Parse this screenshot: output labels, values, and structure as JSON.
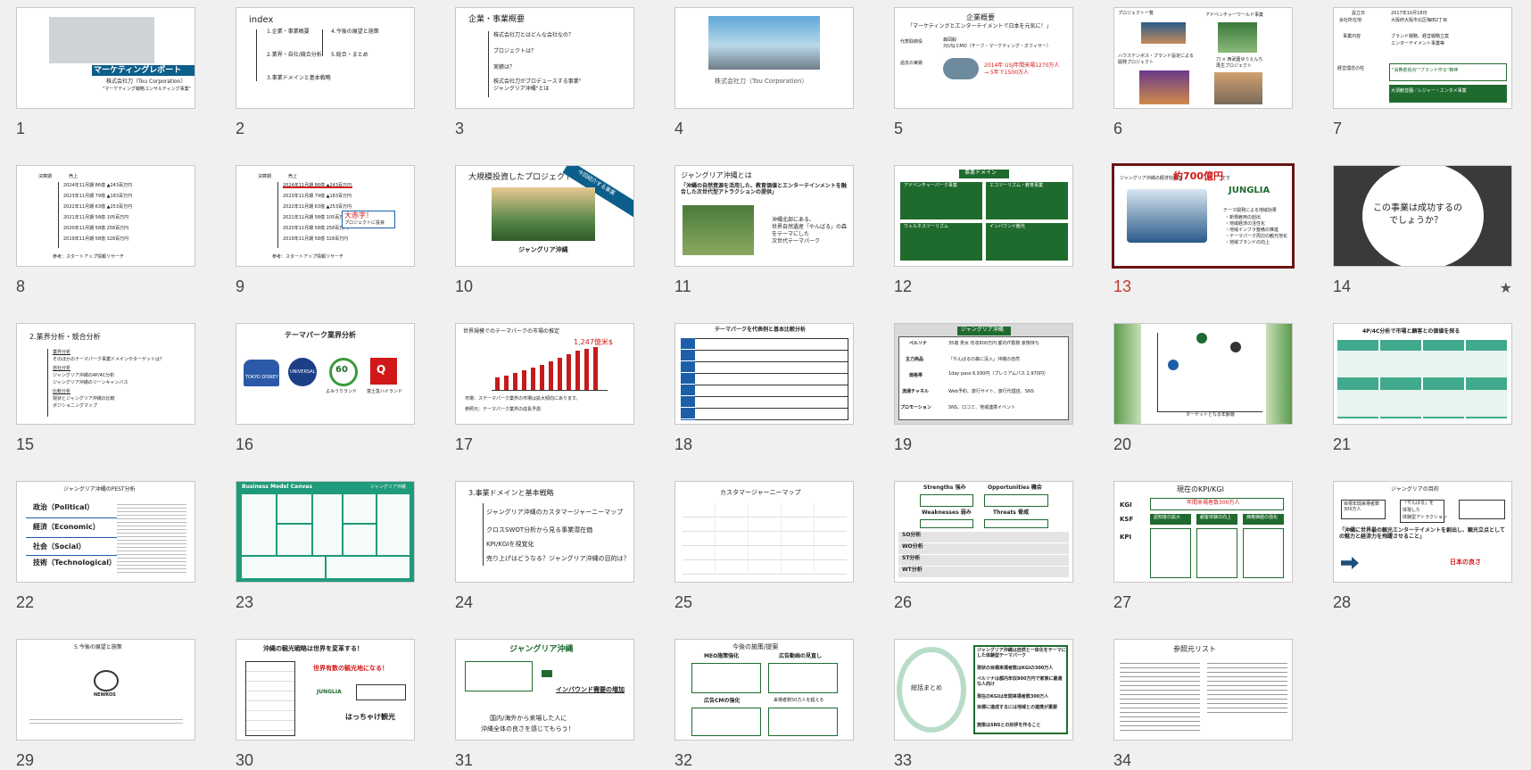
{
  "colors": {
    "accent": "#6b1414",
    "selected_number": "#c0392b",
    "background": "#f0f0f0"
  },
  "slides": [
    {
      "n": "1",
      "title": "マーケティングレポート",
      "l1": "株式会社刀（Tou Corporation）",
      "l2": "\"マーケティング戦略コンサルティング事業\""
    },
    {
      "n": "2",
      "title": "index",
      "items": [
        "1.企業・事業概要",
        "2.業界・自社/競合分析",
        "3.事業ドメインと基本戦略",
        "4.今後の展望と施策",
        "5.総合・まとめ"
      ]
    },
    {
      "n": "3",
      "title": "企業・事業概要",
      "items": [
        "株式会社刀とはどんな会社なの？",
        "プロジェクトは？",
        "実績は？",
        "株式会社刀がプロデュースする事業\"",
        "ジャングリア沖縄\"とは"
      ]
    },
    {
      "n": "4",
      "caption": "株式会社刀（Tou Corporation）"
    },
    {
      "n": "5",
      "title": "企業概要",
      "quote": "「マーケティングとエンターテイメントで日本を元気に！」",
      "labels": [
        "代表取締役",
        "森岡毅",
        "元USJ CMO（チーフ・マーケティング・オフィサー）",
        "過去の実績"
      ],
      "hl1": "2014年 USJ年間来場1270万人",
      "hl2": "→ 5年で1500万人"
    },
    {
      "n": "6",
      "labels": [
        "プロジェクト一覧",
        "アドベンチャーワールド事業",
        "ハウステンボス・ブランド設定による",
        "刀 × 西武園ゆうえんち",
        "再生プロジェクト",
        "開発プロジェクト"
      ]
    },
    {
      "n": "7",
      "rows": [
        "設立日",
        "2017年10月18日",
        "会社所在地",
        "大阪府大阪市北区梅田2丁目",
        "事業内容",
        "ブランド戦略、経営戦略立案",
        "エンターテイメント事業等",
        "経営理念の柱"
      ],
      "band1": "\"消費者視点\"\"ブランド作る\"精神",
      "band2": "大須観音園／レジャー・エンタメ事業"
    },
    {
      "n": "8",
      "head": [
        "決算期",
        "売上"
      ],
      "rows": [
        "2024年11月期 86億 ▲243百万円",
        "2023年11月期 79億 ▲183百万円",
        "2022年11月期 63億 ▲253百万円",
        "2021年11月期 58億 105百万円",
        "2020年11月期 58億 258百万円",
        "2019年11月期 58億 328百万円"
      ],
      "src": "参考：スタートアップ情報リサーチ"
    },
    {
      "n": "9",
      "head": [
        "決算期",
        "売上"
      ],
      "rows": [
        "2024年11月期 86億 ▲243百万円",
        "2023年11月期 79億 ▲183百万円",
        "2022年11月期 63億 ▲253百万円",
        "2021年11月期 58億 105百万円",
        "2020年11月期 58億 258百万円",
        "2019年11月期 58億 328百万円"
      ],
      "callout": "大赤字！",
      "callout2": "プロジェクトに投資",
      "src": "参考：スタートアップ情報リサーチ"
    },
    {
      "n": "10",
      "title": "大規模投資したプロジェクト",
      "ribbon": "今回紹介する事業",
      "caption": "ジャングリア沖縄"
    },
    {
      "n": "11",
      "title": "ジャングリア沖縄とは",
      "quote": "「沖縄の自然資源を活用した、教育価値とエンターテインメントを融合した次世代型アトラクションの提供」",
      "right1": "沖縄北部にある、",
      "right2": "世界自然遺産「やんばる」の森",
      "right3": "をテーマにした",
      "right4": "次世代テーマパーク"
    },
    {
      "n": "12",
      "title": "事業ドメイン",
      "quads": [
        "アドベンチャーパーク事業",
        "エコツーリズム・教育事業",
        "ウェルネスツーリズム",
        "インバウンド観光"
      ]
    },
    {
      "n": "13",
      "head1": "ジャングリア沖縄の経済効果は",
      "big": "約700億円",
      "head2": "です",
      "brand": "JUNGLIA",
      "bullets": [
        "テーマ開発による地域効果",
        "・新規雇用の創出",
        "・地域経済の活性化",
        "・地域インフラ整備の推進",
        "・テーマパーク周辺の観光地化",
        "・地域ブランドの向上"
      ]
    },
    {
      "n": "14",
      "q1": "この事業は成功するの",
      "q2": "でしょうか？",
      "star": "★"
    },
    {
      "n": "15",
      "title": "2.業界分析・競合分析",
      "items": [
        "業界分析",
        "そのほかのテーマパーク事業ドメインやターゲットは？",
        "自社分析",
        "ジャングリア沖縄の4P/4C分析",
        "ジャングリア沖縄のリーンキャンバス",
        "比較分析",
        "現状とジャングリア沖縄の比較",
        "ポジショニングマップ"
      ]
    },
    {
      "n": "16",
      "title": "テーマパーク業界分析",
      "logos": [
        "TOKYO DISNEY RESORT",
        "UNIVERSAL",
        "60",
        "Q"
      ],
      "logo_labels": [
        "",
        "",
        "よみうりランド",
        "富士急ハイランド"
      ]
    },
    {
      "n": "17",
      "title": "世界規模でのテーマパークの市場の推定",
      "value": "1,247億米$",
      "note": "市場：ステーマパーク業界の市場は拡大傾向にあります。",
      "note2": "参照元：テーマパーク業界の成長予測"
    },
    {
      "n": "18",
      "title": "テーマパークを代表例と基本比較分析"
    },
    {
      "n": "19",
      "title": "ジャングリア沖縄",
      "rows": [
        [
          "ペルソナ",
          "35歳 男女 年収800万円 都内IT勤務 家族持ち"
        ],
        [
          "主力商品",
          "「やんばるの森に没入」沖縄の自然"
        ],
        [
          "価格帯",
          "1day pass 6,930円（プレミアムパス 2,970円）"
        ],
        [
          "流通チャネル",
          "Web予約、旅行サイト、旅行代理店、SNS"
        ],
        [
          "プロモーション",
          "SNS、口コミ、地域連携イベント"
        ]
      ]
    },
    {
      "n": "20",
      "axis": "ターゲットとなる年齢層"
    },
    {
      "n": "21",
      "title": "4P/4C分析で市場と顧客との価値を探る"
    },
    {
      "n": "22",
      "title": "ジャングリア沖縄のPEST分析",
      "rows": [
        "政治（Political）",
        "経済（Economic）",
        "社会（Social）",
        "技術（Technological）"
      ]
    },
    {
      "n": "23",
      "title": "Business Model Canvas",
      "tag": "ジャングリア沖縄"
    },
    {
      "n": "24",
      "title": "3.事業ドメインと基本戦略",
      "items": [
        "ジャングリア沖縄のカスタマージャーニーマップ",
        "クロスSWOT分析から見る事業潜在価",
        "KPI/KGIを視覚化",
        "売り上げはどうなる？ジャングリア沖縄の目的は？"
      ]
    },
    {
      "n": "25",
      "title": "カスタマージャーニーマップ"
    },
    {
      "n": "26",
      "swot": [
        "Strengths 強み",
        "Opportunities 機会",
        "Weaknesses 弱み",
        "Threats 脅威"
      ],
      "rows": [
        "SO分析",
        "WO分析",
        "ST分析",
        "WT分析"
      ]
    },
    {
      "n": "27",
      "title": "現在のKPI/KGI",
      "kgi": "KGI",
      "ksf": "KSF",
      "kpi": "KPI",
      "kgi_value": "年間来場者数300万人",
      "ksf_items": [
        "認知度の拡大",
        "顧客体験の向上",
        "価格価値の強化"
      ]
    },
    {
      "n": "28",
      "title": "ジャングリアの目的",
      "left": "目標年間来場者数300万人",
      "mid1": "「やんばる」を",
      "mid2": "体現した",
      "mid3": "体験型アトラクション",
      "quote": "「沖縄に世界最の観光エンターテイメントを創出し、観光立点としての魅力と経済力を飛躍させること」",
      "foot": "日本の良さ"
    },
    {
      "n": "29",
      "title": "5.今後の展望と施策",
      "brand": "NEWROS"
    },
    {
      "n": "30",
      "title": "沖縄の観光戦略は世界を変革する！",
      "big": "世界有数の観光地になる！",
      "callout": "はっちゃけ観光"
    },
    {
      "n": "31",
      "title": "ジャングリア沖縄",
      "banner": "インバウンド需要の増加",
      "foot1": "国内/海外から来場した人に",
      "foot2": "沖縄全体の良さを感じてもらう！"
    },
    {
      "n": "32",
      "title": "今後の施策/提案",
      "cells": [
        "MEO施策強化",
        "広告動画の見直し",
        "広告CMの強化",
        "来場者数50万人を超える"
      ]
    },
    {
      "n": "33",
      "title": "総括まとめ",
      "items": [
        "ジャングリア沖縄は自然と一体化をテーマにした体験型テーマパーク",
        "現状の目標来場者数はKGIの300万人",
        "ペルソナは都内年収800万円で家族に最適な人向け",
        "現在のKGIは年間来場者数300万人",
        "目標に達成するには地域との連携が重要"
      ],
      "extra": "施策はSNSとの好評を作ること"
    },
    {
      "n": "34",
      "title": "参照元リスト"
    }
  ]
}
